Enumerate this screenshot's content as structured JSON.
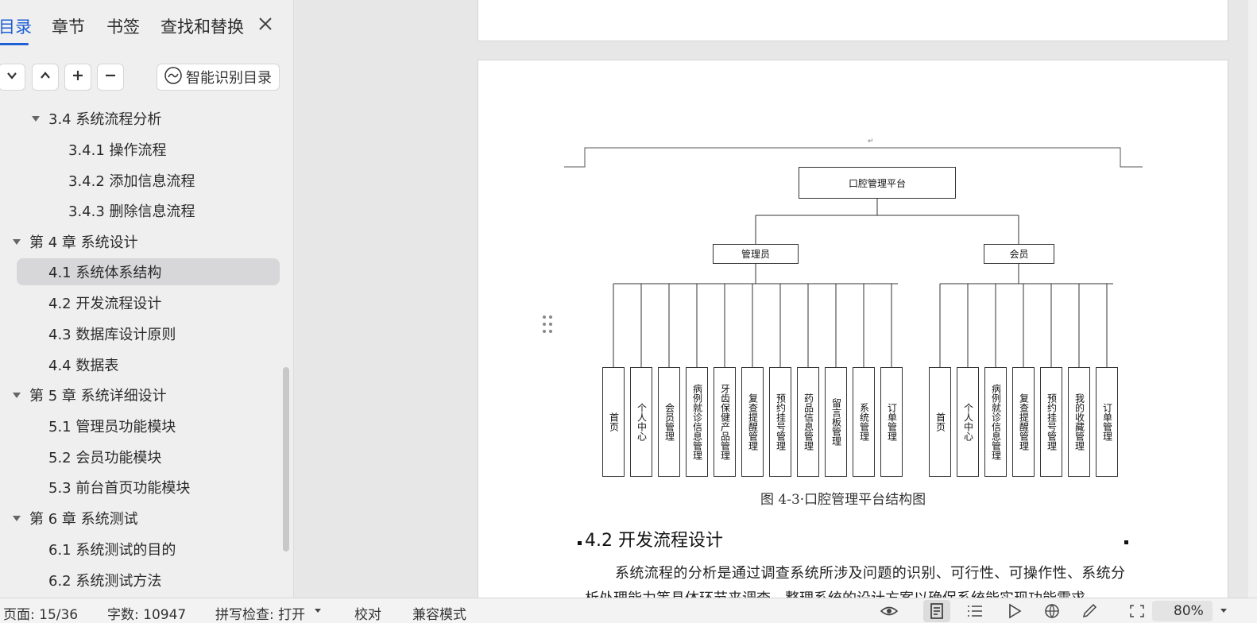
{
  "nav": {
    "tabs": [
      "目录",
      "章节",
      "书签",
      "查找和替换"
    ],
    "smart_toc_label": "智能识别目录",
    "toc": [
      {
        "label": "3.4 系统流程分析",
        "level": 2,
        "expanded": true
      },
      {
        "label": "3.4.1 操作流程",
        "level": 3
      },
      {
        "label": "3.4.2 添加信息流程",
        "level": 3
      },
      {
        "label": "3.4.3 删除信息流程",
        "level": 3
      },
      {
        "label": "第 4 章  系统设计",
        "level": 1,
        "expanded": true
      },
      {
        "label": "4.1  系统体系结构",
        "level": 2,
        "selected": true
      },
      {
        "label": "4.2 开发流程设计",
        "level": 2
      },
      {
        "label": "4.3  数据库设计原则",
        "level": 2
      },
      {
        "label": "4.4  数据表",
        "level": 2
      },
      {
        "label": "第 5 章  系统详细设计",
        "level": 1,
        "expanded": true
      },
      {
        "label": "5.1 管理员功能模块",
        "level": 2
      },
      {
        "label": "5.2 会员功能模块",
        "level": 2
      },
      {
        "label": "5.3 前台首页功能模块",
        "level": 2
      },
      {
        "label": "第 6 章    系统测试",
        "level": 1,
        "expanded": true
      },
      {
        "label": "6.1 系统测试的目的",
        "level": 2
      },
      {
        "label": "6.2 系统测试方法",
        "level": 2
      }
    ]
  },
  "document": {
    "diagram": {
      "root": "口腔管理平台",
      "branches": [
        {
          "name": "管理员",
          "children": [
            "首页",
            "个人中心",
            "会员管理",
            "病例就诊信息管理",
            "牙齿保健产品管理",
            "复查提醒管理",
            "预约挂号管理",
            "药品信息管理",
            "留言板管理",
            "系统管理",
            "订单管理"
          ]
        },
        {
          "name": "会员",
          "children": [
            "首页",
            "个人中心",
            "病例就诊信息管理",
            "复查提醒管理",
            "预约挂号管理",
            "我的收藏管理",
            "订单管理"
          ]
        }
      ]
    },
    "caption": "图 4-3·口腔管理平台结构图",
    "section_heading": "4.2 开发流程设计",
    "body_text": "系统流程的分析是通过调查系统所涉及问题的识别、可行性、可操作性、系统分析处理能力等具体环节来调查，整理系统的设计方案以确保系统能实现功能需求"
  },
  "status_bar": {
    "page": "页面: 15/36",
    "word_count": "字数: 10947",
    "spell_check": "拼写检查: 打开",
    "proofread": "校对",
    "compat_mode": "兼容模式",
    "zoom": "80%"
  },
  "colors": {
    "accent": "#1f5fd6",
    "panel_bg": "#efefef",
    "selected_bg": "#d7d7d9"
  },
  "icons": {
    "close": "close-icon",
    "expand_all": "chevron-down-icon",
    "collapse_all": "chevron-up-icon",
    "add": "plus-icon",
    "remove": "minus-icon",
    "smart": "smart-toc-icon"
  }
}
